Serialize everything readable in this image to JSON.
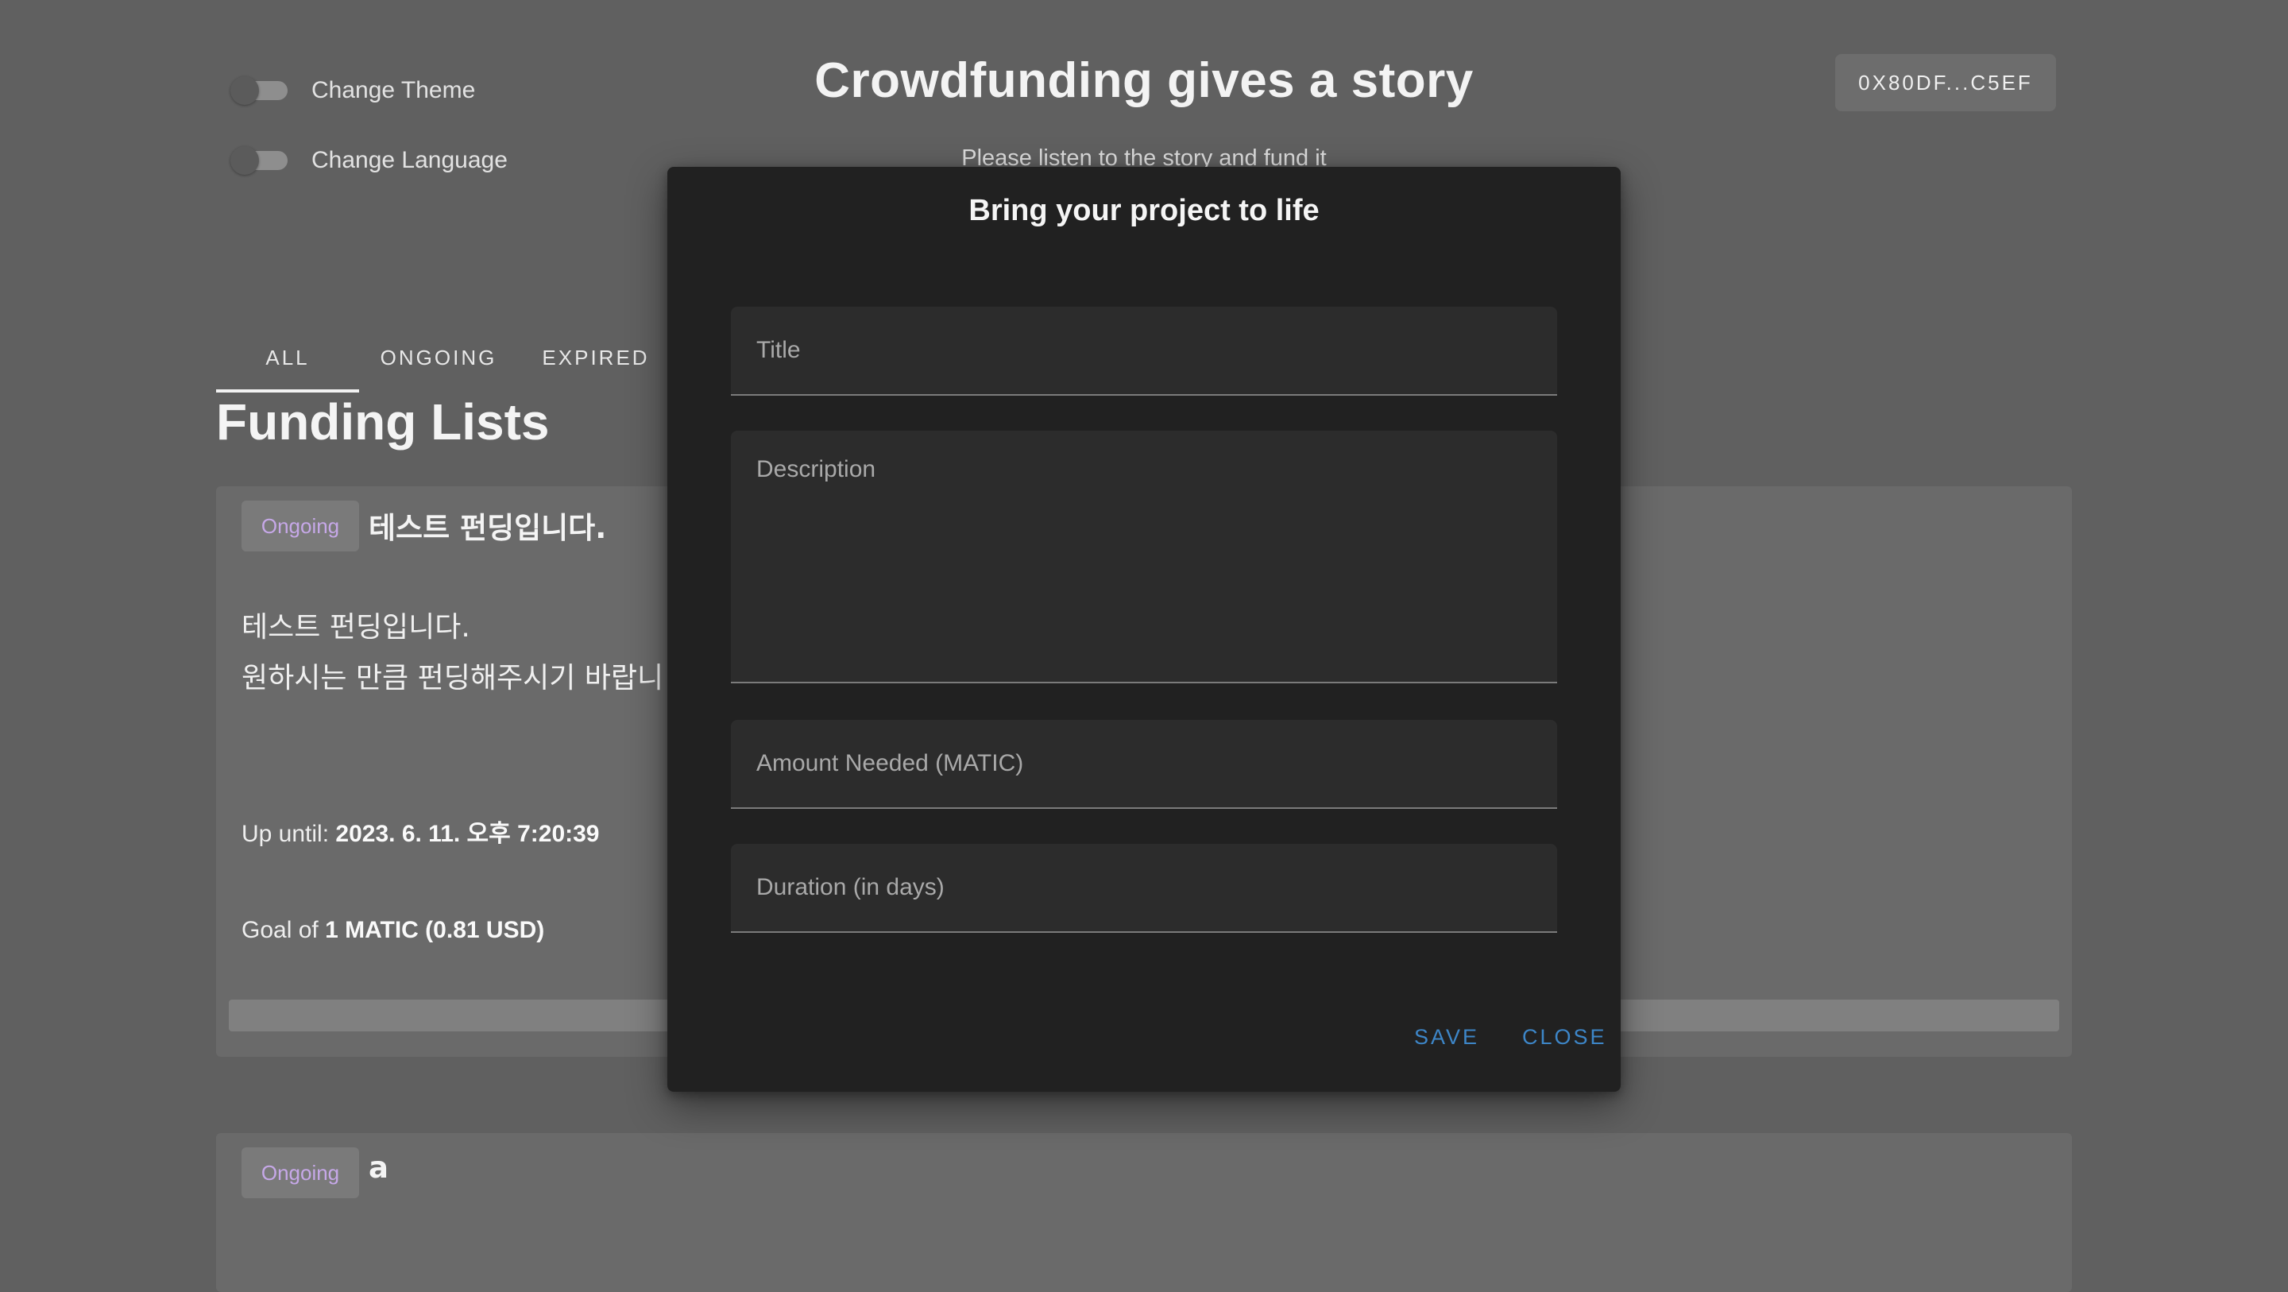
{
  "settings": {
    "theme_label": "Change Theme",
    "language_label": "Change Language"
  },
  "header": {
    "title": "Crowdfunding gives a story",
    "subtitle": "Please listen to the story and fund it",
    "wallet": "0X80DF...C5EF"
  },
  "tabs": [
    "ALL",
    "ONGOING",
    "EXPIRED"
  ],
  "section_title": "Funding Lists",
  "cards": [
    {
      "status": "Ongoing",
      "title": "테스트 펀딩입니다.",
      "description": "테스트 펀딩입니다.\n원하시는 만큼 펀딩해주시기 바랍니",
      "until_label": "Up until:",
      "until_value": "2023. 6. 11. 오후 7:20:39",
      "goal_label": "Goal of",
      "goal_value": "1 MATIC (0.81 USD)"
    },
    {
      "status": "Ongoing",
      "title": "a"
    }
  ],
  "modal": {
    "title": "Bring your project to life",
    "fields": {
      "title": "Title",
      "description": "Description",
      "amount": "Amount Needed (MATIC)",
      "duration": "Duration (in days)"
    },
    "save_label": "SAVE",
    "close_label": "CLOSE"
  }
}
